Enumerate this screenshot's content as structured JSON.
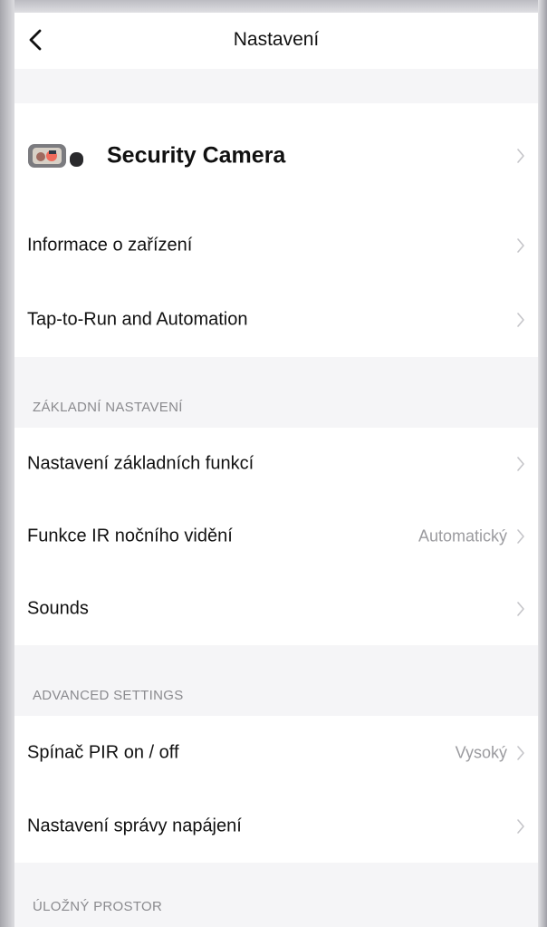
{
  "nav": {
    "title": "Nastavení"
  },
  "device": {
    "name": "Security Camera"
  },
  "items": {
    "device_info": {
      "label": "Informace o zařízení"
    },
    "tap_to_run": {
      "label": "Tap-to-Run and Automation"
    }
  },
  "sections": {
    "basic": {
      "title": "ZÁKLADNÍ NASTAVENÍ",
      "items": [
        {
          "label": "Nastavení základních funkcí",
          "value": ""
        },
        {
          "label": "Funkce IR nočního vidění",
          "value": "Automatický"
        },
        {
          "label": "Sounds",
          "value": ""
        }
      ]
    },
    "advanced": {
      "title": "ADVANCED SETTINGS",
      "items": [
        {
          "label": "Spínač PIR on / off",
          "value": "Vysoký"
        },
        {
          "label": "Nastavení správy napájení",
          "value": ""
        }
      ]
    },
    "storage": {
      "title": "ÚLOŽNÝ PROSTOR"
    }
  },
  "icons": {
    "back": "chevron-left-icon",
    "row_arrow": "chevron-right-icon",
    "device": "camera-device-icon"
  },
  "colors": {
    "text": "#111111",
    "secondary": "#8a8a8e",
    "value": "#9b9b9f",
    "background": "#f5f5f7",
    "card": "#ffffff"
  }
}
